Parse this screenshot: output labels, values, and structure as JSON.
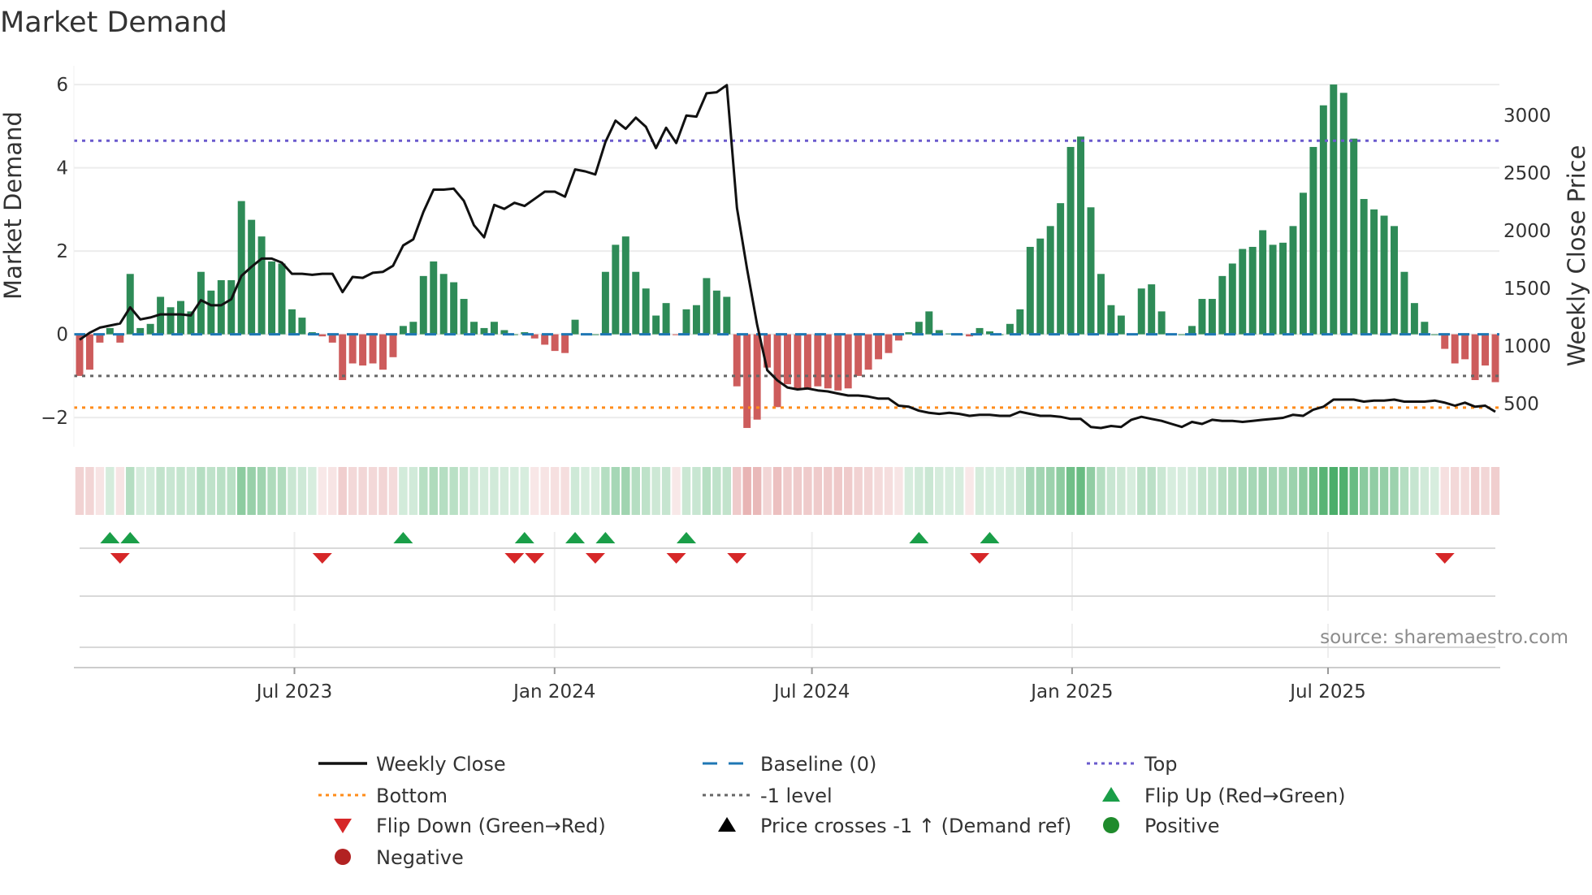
{
  "title": "Market Demand",
  "source": "source: sharemaestro.com",
  "colors": {
    "positive_bar": "#2e8b57",
    "negative_bar": "#cd5c5c",
    "price_line": "#111111",
    "baseline": "#1f77b4",
    "top": "#6a5acd",
    "bottom": "#ff8c1a",
    "minus_one": "#666666",
    "flip_up": "#1a9e48",
    "flip_down": "#d62728",
    "positive_dot": "#1f8b2c",
    "negative_dot": "#b22222",
    "grid": "#ececec",
    "axis": "#cccccc"
  },
  "chart_data": {
    "type": "bar",
    "title": "Market Demand",
    "ylabel": "Market Demand",
    "ylabel_right": "Weekly Close Price",
    "xlabel": "",
    "frequency": "weekly",
    "start_date": "2023-01-30",
    "ylim": [
      -2.7,
      6.45
    ],
    "ylim_right": [
      125,
      3430
    ],
    "yticks": [
      {
        "value": 6,
        "label": "6"
      },
      {
        "value": 4,
        "label": "4"
      },
      {
        "value": 2,
        "label": "2"
      },
      {
        "value": 0,
        "label": "0"
      },
      {
        "value": -2,
        "label": "−2"
      }
    ],
    "yticks_right": [
      {
        "value": 3000,
        "label": "3000"
      },
      {
        "value": 2500,
        "label": "2500"
      },
      {
        "value": 2000,
        "label": "2000"
      },
      {
        "value": 1500,
        "label": "1500"
      },
      {
        "value": 1000,
        "label": "1000"
      },
      {
        "value": 500,
        "label": "500"
      }
    ],
    "xticks": [
      {
        "date": "2023-07-01",
        "label": "Jul 2023"
      },
      {
        "date": "2024-01-01",
        "label": "Jan 2024"
      },
      {
        "date": "2024-07-01",
        "label": "Jul 2024"
      },
      {
        "date": "2025-01-01",
        "label": "Jan 2025"
      },
      {
        "date": "2025-07-01",
        "label": "Jul 2025"
      }
    ],
    "grid": true,
    "legend_position": "bottom",
    "series": [
      {
        "name": "Market Demand",
        "axis": "left",
        "kind": "bar",
        "values": [
          -1.0,
          -0.85,
          -0.2,
          0.15,
          -0.2,
          1.45,
          0.15,
          0.25,
          0.9,
          0.65,
          0.8,
          0.55,
          1.5,
          1.05,
          1.3,
          1.3,
          3.2,
          2.75,
          2.35,
          1.75,
          1.7,
          0.6,
          0.4,
          0.05,
          -0.05,
          -0.2,
          -1.1,
          -0.7,
          -0.75,
          -0.7,
          -0.85,
          -0.55,
          0.2,
          0.3,
          1.4,
          1.75,
          1.45,
          1.25,
          0.85,
          0.3,
          0.15,
          0.3,
          0.1,
          0.0,
          0.05,
          -0.1,
          -0.25,
          -0.4,
          -0.45,
          0.35,
          0.02,
          0.0,
          1.5,
          2.15,
          2.35,
          1.5,
          1.1,
          0.45,
          0.75,
          -0.02,
          0.6,
          0.7,
          1.35,
          1.05,
          0.9,
          -1.25,
          -2.25,
          -2.05,
          -0.8,
          -1.75,
          -1.2,
          -1.3,
          -1.3,
          -1.25,
          -1.3,
          -1.35,
          -1.3,
          -1.0,
          -0.85,
          -0.6,
          -0.45,
          -0.15,
          0.05,
          0.3,
          0.55,
          0.1,
          0.02,
          0.0,
          -0.05,
          0.15,
          0.07,
          0.0,
          0.25,
          0.6,
          2.1,
          2.3,
          2.6,
          3.15,
          4.5,
          4.75,
          3.05,
          1.45,
          0.7,
          0.45,
          0.0,
          1.1,
          1.2,
          0.55,
          0.0,
          0.0,
          0.2,
          0.85,
          0.85,
          1.4,
          1.7,
          2.05,
          2.1,
          2.5,
          2.15,
          2.2,
          2.6,
          3.4,
          4.5,
          5.5,
          6.0,
          5.8,
          4.7,
          3.25,
          3.0,
          2.85,
          2.6,
          1.5,
          0.75,
          0.3,
          0.0,
          -0.35,
          -0.7,
          -0.6,
          -1.1,
          -0.75,
          -1.15
        ]
      },
      {
        "name": "Weekly Close",
        "axis": "right",
        "kind": "line",
        "values": [
          1053,
          1114,
          1158,
          1176,
          1194,
          1334,
          1229,
          1246,
          1273,
          1273,
          1273,
          1264,
          1396,
          1352,
          1352,
          1405,
          1607,
          1686,
          1757,
          1757,
          1722,
          1625,
          1625,
          1616,
          1625,
          1625,
          1466,
          1598,
          1590,
          1634,
          1642,
          1695,
          1871,
          1924,
          2162,
          2355,
          2355,
          2364,
          2258,
          2047,
          1942,
          2223,
          2188,
          2241,
          2214,
          2276,
          2338,
          2338,
          2294,
          2531,
          2514,
          2487,
          2769,
          2954,
          2883,
          2980,
          2901,
          2716,
          2892,
          2760,
          2998,
          2989,
          3191,
          3200,
          3262,
          2197,
          1669,
          1185,
          789,
          701,
          639,
          622,
          630,
          613,
          604,
          586,
          569,
          569,
          560,
          542,
          542,
          481,
          472,
          437,
          419,
          410,
          419,
          410,
          393,
          402,
          402,
          393,
          393,
          428,
          410,
          393,
          393,
          384,
          366,
          366,
          296,
          287,
          305,
          296,
          358,
          384,
          366,
          349,
          322,
          296,
          340,
          322,
          358,
          349,
          349,
          340,
          349,
          358,
          366,
          375,
          402,
          393,
          446,
          472,
          534,
          534,
          534,
          516,
          525,
          525,
          534,
          516,
          516,
          516,
          525,
          507,
          481,
          507,
          472,
          481,
          428
        ]
      }
    ],
    "reference_lines": [
      {
        "name": "Baseline (0)",
        "value": 0,
        "style": "dashed",
        "color_key": "baseline"
      },
      {
        "name": "Top",
        "value": 4.65,
        "style": "dotted",
        "color_key": "top"
      },
      {
        "name": "-1 level",
        "value": -1,
        "style": "dotted",
        "color_key": "minus_one"
      },
      {
        "name": "Bottom",
        "value": -1.76,
        "style": "dotted",
        "color_key": "bottom"
      }
    ],
    "flip_up_weeks": [
      3,
      5,
      32,
      44,
      49,
      52,
      60,
      83,
      90
    ],
    "flip_down_weeks": [
      4,
      24,
      43,
      45,
      51,
      59,
      65,
      89,
      135
    ],
    "legend": [
      {
        "label": "Weekly Close",
        "symbol": "line"
      },
      {
        "label": "Baseline (0)",
        "symbol": "dashed"
      },
      {
        "label": "Top",
        "symbol": "dotted-top"
      },
      {
        "label": "Bottom",
        "symbol": "dotted-bottom"
      },
      {
        "label": "-1 level",
        "symbol": "dotted-minus-one"
      },
      {
        "label": "Flip Up (Red→Green)",
        "symbol": "triangle-up"
      },
      {
        "label": "Flip Down (Green→Red)",
        "symbol": "triangle-down"
      },
      {
        "label": "Price crosses -1 ↑ (Demand ref)",
        "symbol": "triangle-up-black"
      },
      {
        "label": "Positive",
        "symbol": "dot-positive"
      },
      {
        "label": "Negative",
        "symbol": "dot-negative"
      }
    ]
  }
}
